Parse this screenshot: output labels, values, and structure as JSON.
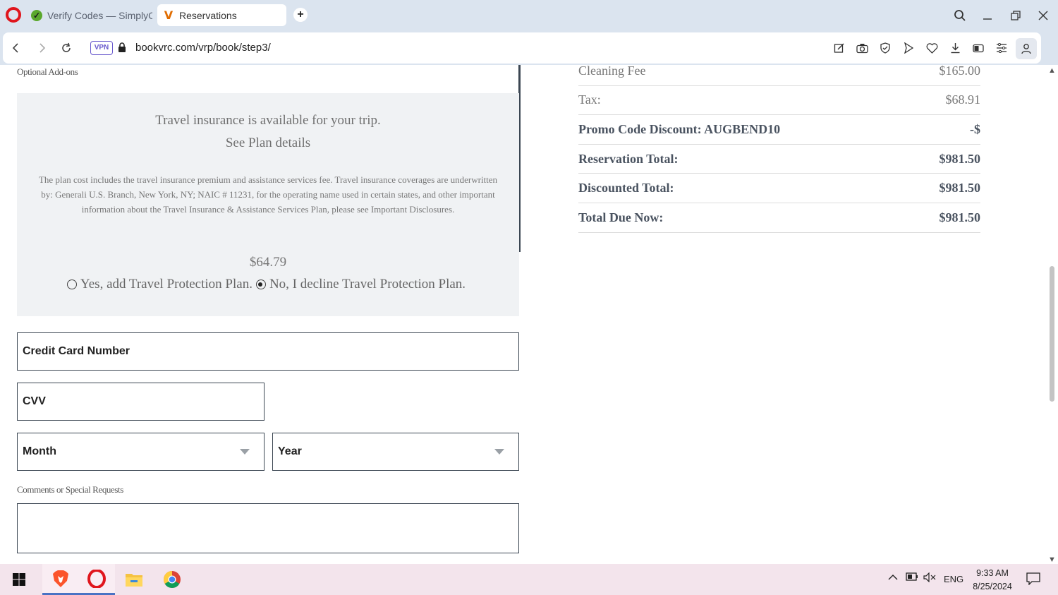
{
  "browser": {
    "tabs": [
      {
        "title": "Verify Codes — SimplyCodes",
        "favicon": "simplycodes-icon",
        "active": false
      },
      {
        "title": "Reservations",
        "favicon": "v-logo-icon",
        "active": true
      }
    ],
    "url": "bookvrc.com/vrp/book/step3/",
    "vpn_label": "VPN"
  },
  "page": {
    "addons_label": "Optional Add-ons",
    "insurance": {
      "headline": "Travel insurance is available for your trip.",
      "plan_link": "See Plan details",
      "body": "The plan cost includes the travel insurance premium and assistance services fee. Travel insurance coverages are underwritten by: Generali U.S. Branch, New York, NY; NAIC # 11231, for the operating name used in certain states, and other important information about the Travel Insurance & Assistance Services Plan, please see Important Disclosures.",
      "price": "$64.79",
      "option_yes": "Yes, add Travel Protection Plan.",
      "option_no": "No, I decline Travel Protection Plan.",
      "selected": "no"
    },
    "payment": {
      "card_number_placeholder": "Credit Card Number",
      "cvv_placeholder": "CVV",
      "month_label": "Month",
      "year_label": "Year",
      "comments_label": "Comments or Special Requests",
      "comments_value": ""
    },
    "summary": [
      {
        "label": "Cleaning Fee",
        "value": "$165.00",
        "bold": false
      },
      {
        "label": "Tax:",
        "value": "$68.91",
        "bold": false
      },
      {
        "label": "Promo Code Discount: AUGBEND10",
        "value": "-$",
        "bold": true
      },
      {
        "label": "Reservation Total:",
        "value": "$981.50",
        "bold": true
      },
      {
        "label": "Discounted Total:",
        "value": "$981.50",
        "bold": true
      },
      {
        "label": "Total Due Now:",
        "value": "$981.50",
        "bold": true
      }
    ]
  },
  "taskbar": {
    "apps": [
      "windows-start-icon",
      "brave-icon",
      "opera-icon",
      "file-explorer-icon",
      "chrome-icon"
    ],
    "language": "ENG",
    "time": "9:33 AM",
    "date": "8/25/2024"
  },
  "colors": {
    "chrome_bg": "#dbe4ef",
    "panel_bg": "#f0f2f4",
    "field_border": "#3b4652",
    "accent": "#5b3cf5",
    "taskbar_bg": "#f3e4ec"
  }
}
